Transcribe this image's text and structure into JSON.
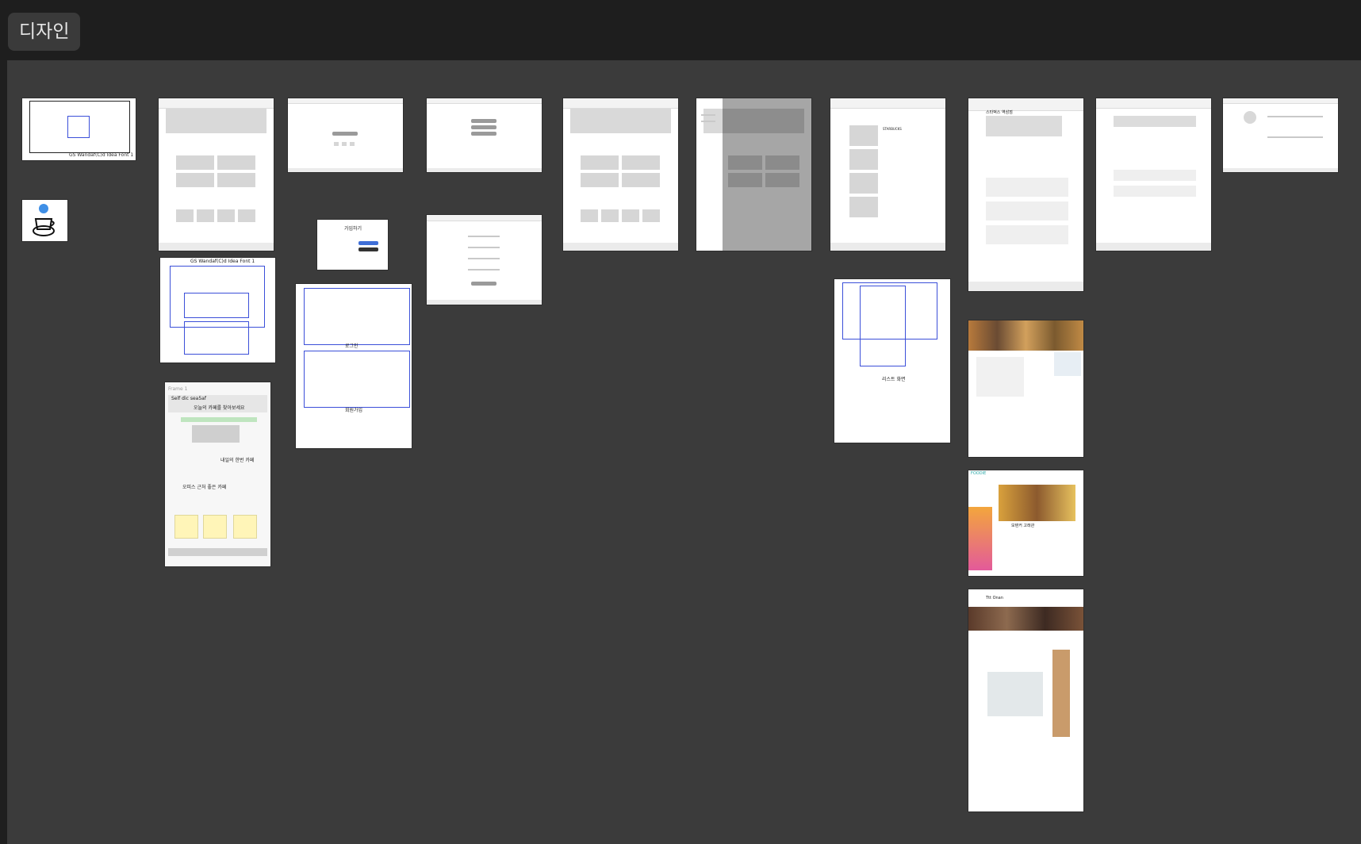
{
  "page": {
    "section_title": "디자인"
  },
  "frames": {
    "a_label": "GS Wandaf(C)d Idea Font 1",
    "sketch1_title": "GS Wandaf(C)d Idea Font 1",
    "sketch_frame_title": "Frame 1",
    "sketch_frame_line1": "Self dic sea5af",
    "sketch_frame_line2": "오늘의 카페를 찾아보세요",
    "sketch_frame_row1": "내일의 한번 카페",
    "sketch_frame_row2": "오피스 근처 좋은 카페",
    "signup_title": "가입하기",
    "sketch2_label1": "로그인",
    "sketch2_label2": "회원가입",
    "sketch3_label": "리스트 화면",
    "list_brand": "STARBUCKS",
    "detail_title": "스타벅스 역삼점",
    "ref2_logo": "FOODIE",
    "ref2_name": "모텐커 고래관",
    "ref3_brand": "Ttt Onan"
  }
}
